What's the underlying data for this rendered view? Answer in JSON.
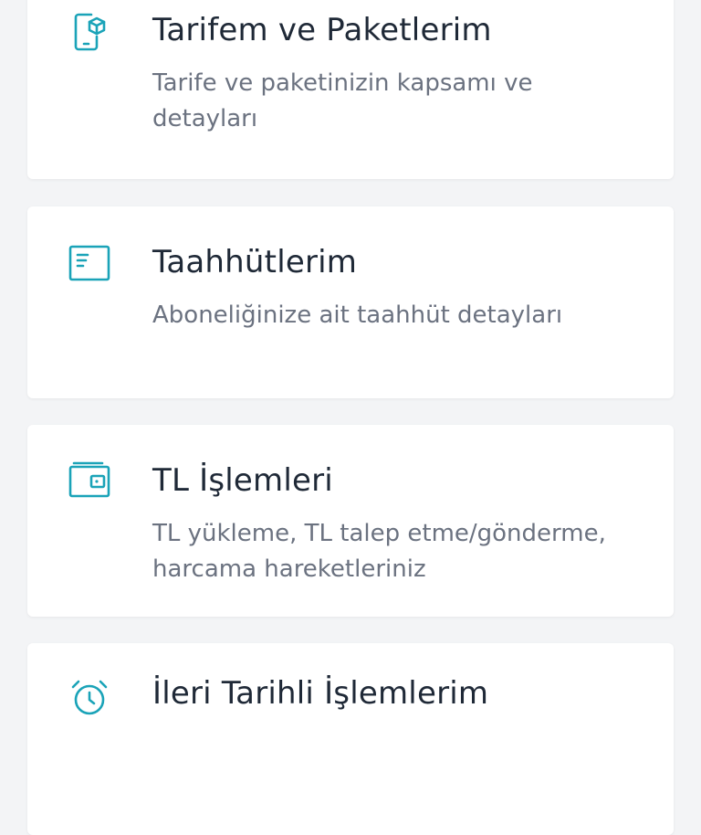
{
  "colors": {
    "page_background": "#f3f4f6",
    "card_background": "#ffffff",
    "icon_accent": "#1aa3b8",
    "title_text": "#1f2937",
    "description_text": "#6b7280"
  },
  "menu": {
    "items": [
      {
        "icon": "phone-package-icon",
        "title": "Tarifem ve Paketlerim",
        "description": "Tarife ve paketinizin kapsamı ve detayları"
      },
      {
        "icon": "contract-document-icon",
        "title": "Taahhütlerim",
        "description": "Aboneliğinize ait taahhüt detayları"
      },
      {
        "icon": "wallet-icon",
        "title": "TL İşlemleri",
        "description": "TL yükleme, TL talep etme/gönderme, harcama hareketleriniz"
      },
      {
        "icon": "alarm-clock-icon",
        "title": "İleri Tarihli İşlemlerim",
        "description": ""
      }
    ]
  }
}
